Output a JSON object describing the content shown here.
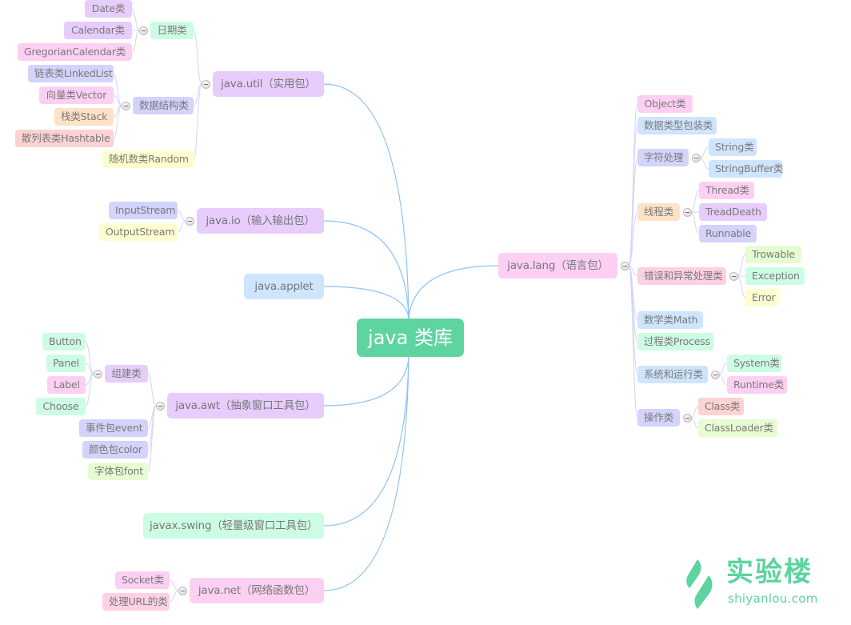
{
  "title": "java 类库",
  "colors": {
    "root": "#5ed4a0",
    "link_main": "#8fc3f5",
    "link_sub": "#d4d4f7",
    "purple": "#e6cdfc",
    "lavender": "#d3d3fc",
    "pink": "#fdd0f3",
    "rose": "#fdd0e2",
    "salmon": "#fdd2d2",
    "peach": "#fde2c8",
    "yellow": "#fefdd0",
    "mint": "#cdfce4",
    "lime": "#e6fdd2",
    "blue": "#cfe4fd"
  },
  "mindmap": {
    "root": {
      "label": "java 类库"
    },
    "left": [
      {
        "id": "util",
        "label": "java.util（实用包）",
        "color": "purple",
        "children": [
          {
            "id": "date",
            "label": "日期类",
            "color": "mint",
            "children": [
              {
                "id": "date1",
                "label": "Date类",
                "color": "purple"
              },
              {
                "id": "date2",
                "label": "Calendar类",
                "color": "purple"
              },
              {
                "id": "date3",
                "label": "GregorianCalendar类",
                "color": "pink"
              }
            ]
          },
          {
            "id": "ds",
            "label": "数据结构类",
            "color": "lavender",
            "children": [
              {
                "id": "ds1",
                "label": "链表类LinkedList",
                "color": "lavender"
              },
              {
                "id": "ds2",
                "label": "向量类Vector",
                "color": "pink"
              },
              {
                "id": "ds3",
                "label": "栈类Stack",
                "color": "peach"
              },
              {
                "id": "ds4",
                "label": "散列表类Hashtable",
                "color": "salmon"
              }
            ]
          },
          {
            "id": "rand",
            "label": "随机数类Random",
            "color": "yellow"
          }
        ]
      },
      {
        "id": "io",
        "label": "java.io（输入输出包）",
        "color": "purple",
        "children": [
          {
            "id": "io1",
            "label": "InputStream",
            "color": "lavender"
          },
          {
            "id": "io2",
            "label": "OutputStream",
            "color": "yellow"
          }
        ]
      },
      {
        "id": "applet",
        "label": "java.applet",
        "color": "blue"
      },
      {
        "id": "awt",
        "label": "java.awt（抽象窗口工具包）",
        "color": "purple",
        "children": [
          {
            "id": "comp",
            "label": "组建类",
            "color": "purple",
            "children": [
              {
                "id": "c1",
                "label": "Button",
                "color": "mint"
              },
              {
                "id": "c2",
                "label": "Panel",
                "color": "mint"
              },
              {
                "id": "c3",
                "label": "Label",
                "color": "pink"
              },
              {
                "id": "c4",
                "label": "Choose",
                "color": "mint"
              }
            ]
          },
          {
            "id": "evt",
            "label": "事件包event",
            "color": "lavender"
          },
          {
            "id": "col",
            "label": "颜色包color",
            "color": "lavender"
          },
          {
            "id": "font",
            "label": "字体包font",
            "color": "lime"
          }
        ]
      },
      {
        "id": "swing",
        "label": "javax.swing（轻量级窗口工具包）",
        "color": "mint"
      },
      {
        "id": "net",
        "label": "java.net（网络函数包）",
        "color": "pink",
        "children": [
          {
            "id": "n1",
            "label": "Socket类",
            "color": "pink"
          },
          {
            "id": "n2",
            "label": "处理URL的类",
            "color": "rose"
          }
        ]
      }
    ],
    "right": [
      {
        "id": "lang",
        "label": "java.lang（语言包）",
        "color": "pink",
        "children": [
          {
            "id": "obj",
            "label": "Object类",
            "color": "pink"
          },
          {
            "id": "wrap",
            "label": "数据类型包装类",
            "color": "blue"
          },
          {
            "id": "str",
            "label": "字符处理",
            "color": "lavender",
            "children": [
              {
                "id": "s1",
                "label": "String类",
                "color": "blue"
              },
              {
                "id": "s2",
                "label": "StringBuffer类",
                "color": "blue"
              }
            ]
          },
          {
            "id": "thr",
            "label": "线程类",
            "color": "peach",
            "children": [
              {
                "id": "t1",
                "label": "Thread类",
                "color": "pink"
              },
              {
                "id": "t2",
                "label": "TreadDeath",
                "color": "purple"
              },
              {
                "id": "t3",
                "label": "Runnable",
                "color": "lavender"
              }
            ]
          },
          {
            "id": "err",
            "label": "错误和异常处理类",
            "color": "rose",
            "children": [
              {
                "id": "e1",
                "label": "Trowable",
                "color": "lime"
              },
              {
                "id": "e2",
                "label": "Exception",
                "color": "mint"
              },
              {
                "id": "e3",
                "label": "Error",
                "color": "yellow"
              }
            ]
          },
          {
            "id": "math",
            "label": "数学类Math",
            "color": "blue"
          },
          {
            "id": "proc",
            "label": "过程类Process",
            "color": "mint"
          },
          {
            "id": "sys",
            "label": "系统和运行类",
            "color": "blue",
            "children": [
              {
                "id": "y1",
                "label": "System类",
                "color": "mint"
              },
              {
                "id": "y2",
                "label": "Runtime类",
                "color": "pink"
              }
            ]
          },
          {
            "id": "op",
            "label": "操作类",
            "color": "lavender",
            "children": [
              {
                "id": "o1",
                "label": "Class类",
                "color": "salmon"
              },
              {
                "id": "o2",
                "label": "ClassLoader类",
                "color": "lime"
              }
            ]
          }
        ]
      }
    ]
  },
  "logo": {
    "name_cn": "实验楼",
    "domain": "shiyanlou.com"
  }
}
